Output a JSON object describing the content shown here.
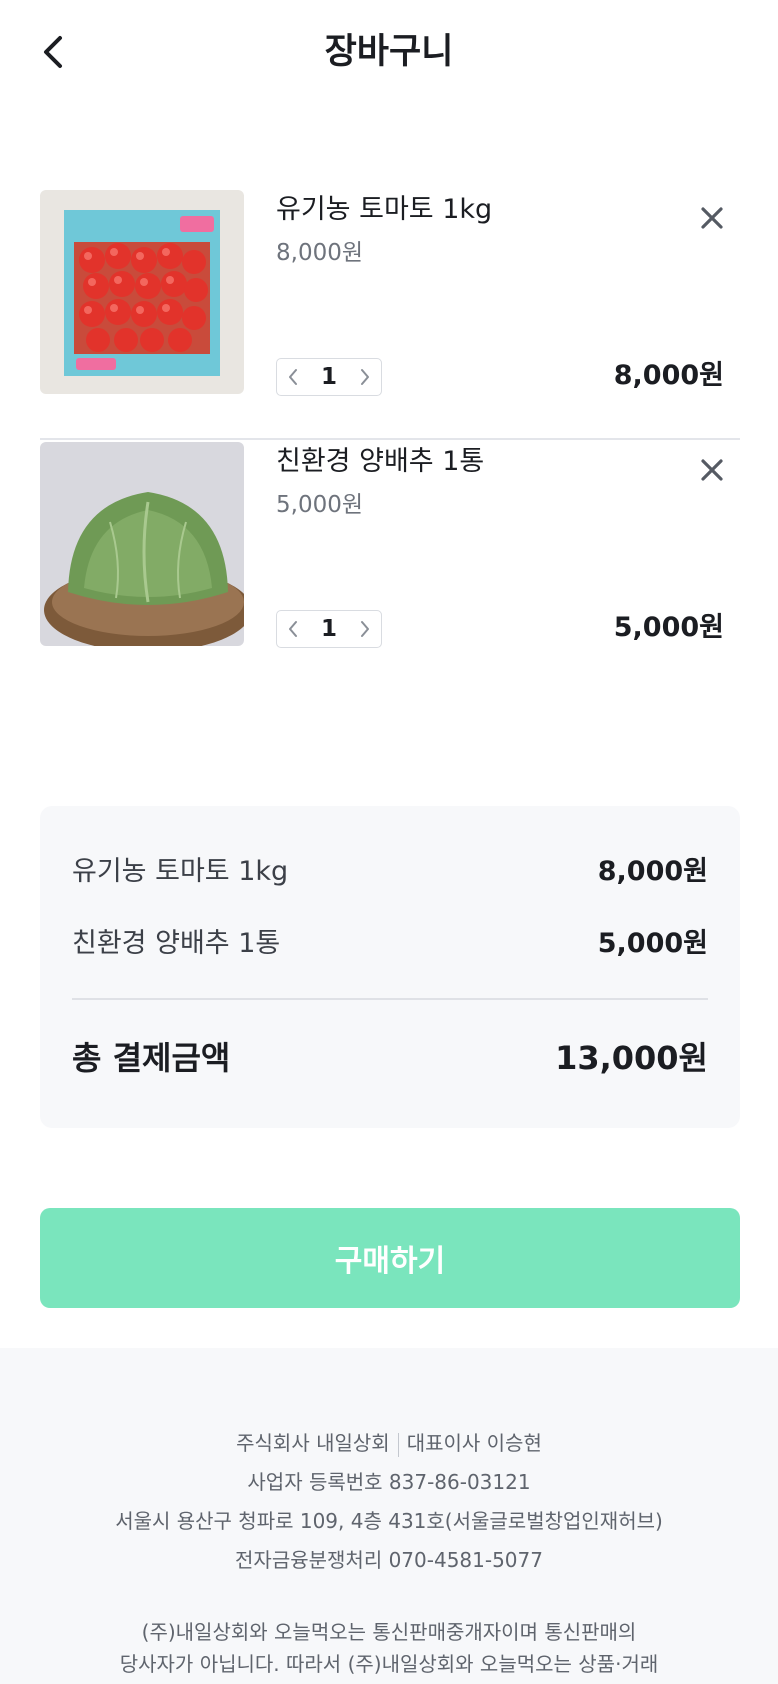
{
  "header": {
    "title": "장바구니",
    "back_icon": "chevron-left-icon"
  },
  "cart": {
    "items": [
      {
        "name": "유기농 토마토 1kg",
        "unit_price": "8,000원",
        "quantity": "1",
        "total": "8,000원",
        "image": "tomato-box-image"
      },
      {
        "name": "친환경 양배추 1통",
        "unit_price": "5,000원",
        "quantity": "1",
        "total": "5,000원",
        "image": "cabbage-image"
      }
    ]
  },
  "summary": {
    "rows": [
      {
        "label": "유기농 토마토 1kg",
        "amount": "8,000원"
      },
      {
        "label": "친환경 양배추 1통",
        "amount": "5,000원"
      }
    ],
    "total_label": "총 결제금액",
    "total_amount": "13,000원"
  },
  "purchase_button": {
    "label": "구매하기",
    "color": "#7ae5bd"
  },
  "footer": {
    "company": "주식회사 내일상회",
    "ceo": "대표이사 이승현",
    "business_no": "사업자 등록번호 837-86-03121",
    "address": "서울시 용산구 청파로 109, 4층 431호(서울글로벌창업인재허브)",
    "dispute": "전자금융분쟁처리 070-4581-5077",
    "notice_line1": "(주)내일상회와 오늘먹오는 통신판매중개자이며 통신판매의",
    "notice_line2": "당사자가 아닙니다. 따라서 (주)내일상회와 오늘먹오는 상품·거래"
  }
}
